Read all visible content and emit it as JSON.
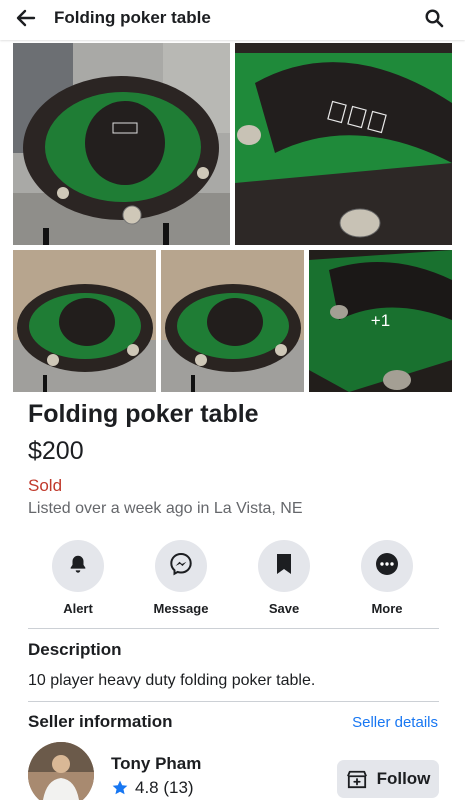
{
  "header": {
    "title": "Folding poker table",
    "back_icon": "arrow-left-icon",
    "search_icon": "search-icon"
  },
  "photos": {
    "more_count_label": "+1"
  },
  "listing": {
    "title": "Folding poker table",
    "price": "$200",
    "status": "Sold",
    "listed_text": "Listed over a week ago in La Vista, NE"
  },
  "actions": [
    {
      "label": "Alert",
      "icon": "bell-icon"
    },
    {
      "label": "Message",
      "icon": "messenger-icon"
    },
    {
      "label": "Save",
      "icon": "bookmark-icon"
    },
    {
      "label": "More",
      "icon": "more-dots-icon"
    }
  ],
  "description": {
    "title": "Description",
    "text": "10 player heavy duty folding poker table."
  },
  "seller": {
    "section_title": "Seller information",
    "details_link": "Seller details",
    "name": "Tony Pham",
    "rating": "4.8 (13)",
    "follow_label": "Follow"
  },
  "colors": {
    "link": "#1877f2",
    "sold": "#c0392b",
    "button_bg": "#e4e6eb",
    "felt_green": "#1e8a3a"
  }
}
